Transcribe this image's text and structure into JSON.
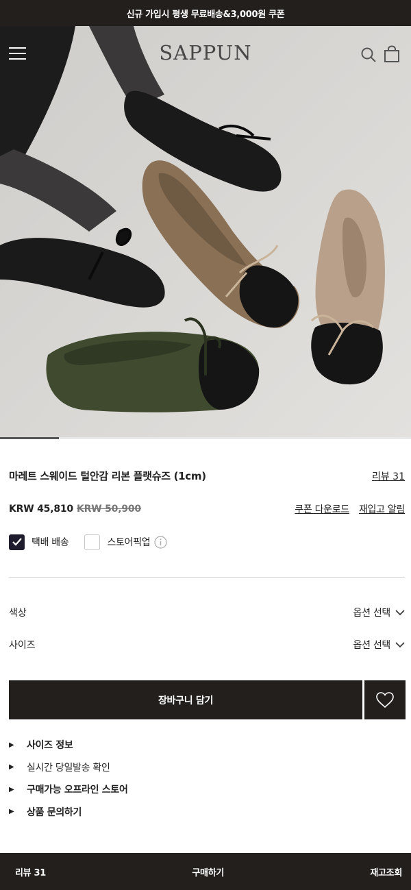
{
  "promo": {
    "text": "신규 가입시 평생 무료배송&3,000원 쿠폰"
  },
  "header": {
    "logo": "SAPPUN",
    "menu_icon": "hamburger-menu-icon",
    "search_icon": "search-icon",
    "cart_icon": "shopping-bag-icon"
  },
  "hero": {
    "slide_progress": 0.143
  },
  "product": {
    "title": "마레트 스웨이드 털안감 리본 플랫슈즈 (1cm)",
    "review_link": "리뷰 31",
    "price_sale": "KRW 45,810",
    "price_original": "KRW 50,900",
    "coupon_link": "쿠폰 다운로드",
    "restock_link": "재입고 알림"
  },
  "delivery": {
    "parcel": {
      "label": "택배 배송",
      "checked": true
    },
    "store_pickup": {
      "label": "스토어픽업",
      "checked": false
    }
  },
  "options": [
    {
      "label": "색상",
      "value": "옵션 선택"
    },
    {
      "label": "사이즈",
      "value": "옵션 선택"
    }
  ],
  "actions": {
    "add_to_cart": "장바구니 담기",
    "wishlist_icon": "heart-icon"
  },
  "info_items": [
    {
      "label": "사이즈 정보",
      "bold": true
    },
    {
      "label": "실시간 당일발송 확인",
      "bold": false
    },
    {
      "label": "구매가능 오프라인 스토어",
      "bold": true
    },
    {
      "label": "상품 문의하기",
      "bold": true
    }
  ],
  "bottom_bar": {
    "review": "리뷰 31",
    "buy": "구매하기",
    "stock": "재고조회"
  },
  "colors": {
    "dark": "#231f1d",
    "checkbox": "#1f1c2e",
    "hero_bg": "#d9d8d5"
  }
}
